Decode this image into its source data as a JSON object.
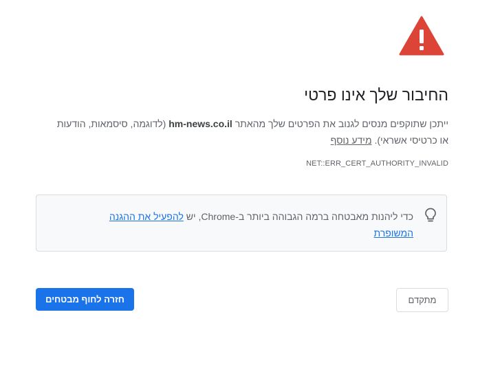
{
  "warning": {
    "icon": "warning-triangle-icon",
    "color": "#db4437"
  },
  "title": "החיבור שלך אינו פרטי",
  "description": {
    "before_domain": "ייתכן שתוקפים מנסים לגנוב את הפרטים שלך מהאתר ",
    "domain": "hm-news.co.il",
    "after_domain": " (לדוגמה, סיסמאות, הודעות או כרטיסי אשראי). ",
    "learn_more": "מידע נוסף"
  },
  "error_code": "NET::ERR_CERT_AUTHORITY_INVALID",
  "enhanced_protection": {
    "icon": "lightbulb-icon",
    "text": "כדי ליהנות מאבטחה ברמה הגבוהה ביותר ב-Chrome, יש ",
    "link": "להפעיל את ההגנה המשופרת"
  },
  "buttons": {
    "back_to_safety": "חזרה לחוף מבטחים",
    "advanced": "מתקדם"
  },
  "colors": {
    "primary_button": "#1a73e8",
    "link": "#1a73e8",
    "box_background": "#f8f9fa"
  }
}
